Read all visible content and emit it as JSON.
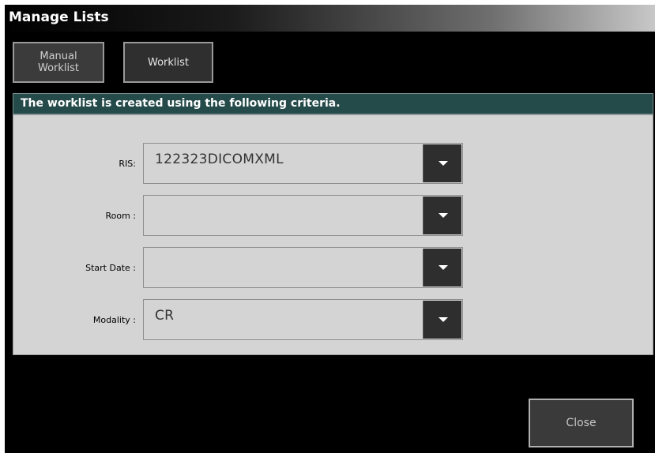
{
  "window": {
    "title": "Manage Lists"
  },
  "tabs": [
    {
      "label_line1": "Manual",
      "label_line2": "Worklist"
    },
    {
      "label": "Worklist"
    }
  ],
  "criteria": {
    "header": "The worklist is created using the following criteria.",
    "fields": [
      {
        "label": "RIS:",
        "value": "122323DICOMXML"
      },
      {
        "label": "Room :",
        "value": ""
      },
      {
        "label": "Start Date :",
        "value": ""
      },
      {
        "label": "Modality :",
        "value": "CR"
      }
    ]
  },
  "footer": {
    "close_label": "Close"
  },
  "icons": {
    "dropdown": "chevron-down-icon"
  },
  "colors": {
    "window_bg": "#000000",
    "header_bg": "#254a4a",
    "panel_bg": "#d4d4d4",
    "button_bg": "#2e2e2e"
  }
}
